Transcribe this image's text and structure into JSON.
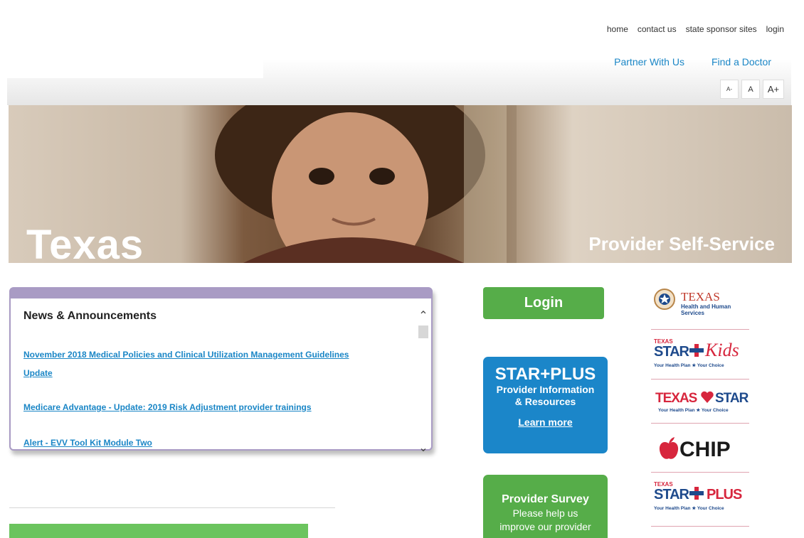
{
  "header": {
    "top_links": [
      "home",
      "contact us",
      "state sponsor sites",
      "login"
    ],
    "nav_links": [
      "Partner With Us",
      "Find a Doctor"
    ],
    "font_size_controls": [
      "A-",
      "A",
      "A+"
    ]
  },
  "banner": {
    "title": "Texas",
    "subtitle": "Provider Self-Service"
  },
  "news": {
    "heading": "News & Announcements",
    "items": [
      "November 2018 Medical Policies and Clinical Utilization Management Guidelines",
      "Update",
      "Medicare Advantage - Update: 2019 Risk Adjustment provider trainings",
      "Alert - EVV Tool Kit Module Two"
    ]
  },
  "login_button": "Login",
  "starplus": {
    "title": "STAR+PLUS",
    "line1": "Provider Information",
    "line2": "& Resources",
    "link": "Learn more"
  },
  "survey": {
    "title": "Provider Survey",
    "line1": "Please help us",
    "line2": "improve our provider"
  },
  "logos": {
    "hhs": {
      "name": "TEXAS",
      "sub1": "Health and Human",
      "sub2": "Services"
    },
    "starkids": {
      "small": "TEXAS",
      "name": "STAR",
      "script": "Kids",
      "tagline": "Your Health Plan ★ Your Choice"
    },
    "texasstar": {
      "left": "TEXAS",
      "right": "STAR",
      "tagline": "Your Health Plan ★ Your Choice"
    },
    "chip": {
      "name": "CHIP"
    },
    "starplus": {
      "small": "TEXAS",
      "name": "STAR",
      "plus": "PLUS",
      "tagline": "Your Health Plan ★ Your Choice"
    }
  },
  "colors": {
    "link": "#1a86c6",
    "green": "#56ad49",
    "blue": "#1b86c9",
    "news_border": "#a99bc4",
    "logo_red": "#d7263d",
    "logo_blue": "#1e4a8c"
  }
}
